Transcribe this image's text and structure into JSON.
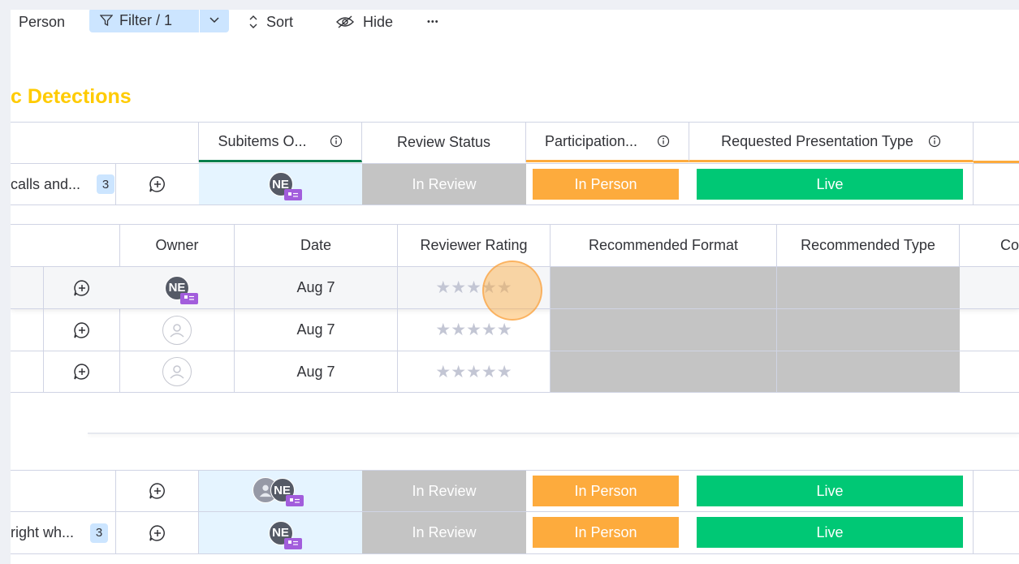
{
  "toolbar": {
    "person_label": "Person",
    "filter_label": "Filter / 1",
    "sort_label": "Sort",
    "hide_label": "Hide",
    "more_label": "•••"
  },
  "group": {
    "title": "c Detections",
    "title_color": "#ffcb00"
  },
  "top_table": {
    "headers": {
      "subitems": "Subitems O...",
      "review_status": "Review Status",
      "participation": "Participation...",
      "presentation_type": "Requested Presentation Type"
    },
    "row": {
      "name": "calls and...",
      "count": "3",
      "owner_initials": "NE",
      "review_status": "In Review",
      "participation": "In Person",
      "presentation_type": "Live"
    }
  },
  "subitems_table": {
    "headers": {
      "owner": "Owner",
      "date": "Date",
      "reviewer_rating": "Reviewer Rating",
      "recommended_format": "Recommended Format",
      "recommended_type": "Recommended Type",
      "next_col": "Co"
    },
    "rows": [
      {
        "owner_initials": "NE",
        "date": "Aug 7",
        "rating": 0,
        "max_rating": 5
      },
      {
        "owner_initials": "",
        "date": "Aug 7",
        "rating": 0,
        "max_rating": 5
      },
      {
        "owner_initials": "",
        "date": "Aug 7",
        "rating": 0,
        "max_rating": 5
      }
    ],
    "star_glyphs": "★★★★★"
  },
  "bottom_rows": [
    {
      "name": "",
      "count": "",
      "owner_initials": "NE",
      "review_status": "In Review",
      "participation": "In Person",
      "presentation_type": "Live"
    },
    {
      "name": "right wh...",
      "count": "3",
      "owner_initials": "NE",
      "review_status": "In Review",
      "participation": "In Person",
      "presentation_type": "Live"
    }
  ],
  "colors": {
    "status_gray": "#c4c4c4",
    "status_orange": "#fdab3d",
    "status_green": "#00c875",
    "filter_bg": "#cce5ff",
    "avatar_badge": "#a25ddc"
  }
}
